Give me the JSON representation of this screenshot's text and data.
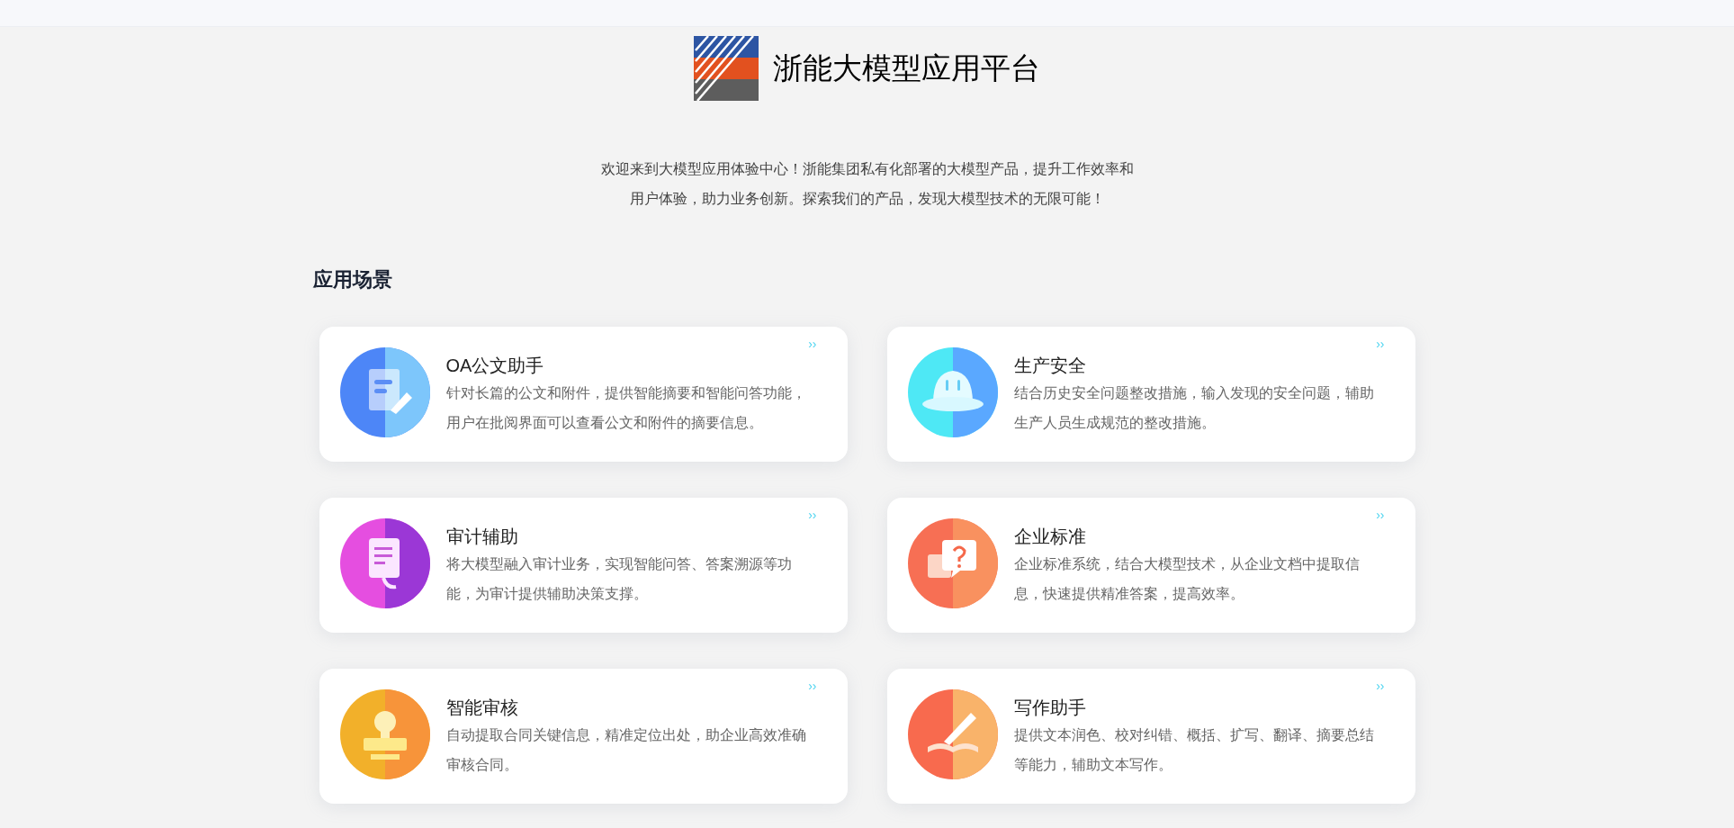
{
  "header": {
    "title": "浙能大模型应用平台"
  },
  "intro": {
    "lines": [
      "欢迎来到大模型应用体验中心！浙能集团私有化部署的大模型产品，提升工作效率和",
      "用户体验，助力业务创新。探索我们的产品，发现大模型技术的无限可能！"
    ]
  },
  "section": {
    "title": "应用场景"
  },
  "cards": [
    {
      "kind": "document",
      "title": "OA公文助手",
      "description": "针对长篇的公文和附件，提供智能摘要和智能问答功能，用户在批阅界面可以查看公文和附件的摘要信息。",
      "more": "››"
    },
    {
      "kind": "helmet",
      "title": "生产安全",
      "description": "结合历史安全问题整改措施，输入发现的安全问题，辅助生产人员生成规范的整改措施。",
      "more": "››"
    },
    {
      "kind": "report",
      "title": "审计辅助",
      "description": "将大模型融入审计业务，实现智能问答、答案溯源等功能，为审计提供辅助决策支撑。",
      "more": "››"
    },
    {
      "kind": "question",
      "title": "企业标准",
      "description": "企业标准系统，结合大模型技术，从企业文档中提取信息，快速提供精准答案，提高效率。",
      "more": "››"
    },
    {
      "kind": "stamp",
      "title": "智能审核",
      "description": "自动提取合同关键信息，精准定位出处，助企业高效准确审核合同。",
      "more": "››"
    },
    {
      "kind": "pen",
      "title": "写作助手",
      "description": "提供文本润色、校对纠错、概括、扩写、翻译、摘要总结等能力，辅助文本写作。",
      "more": "››"
    }
  ]
}
